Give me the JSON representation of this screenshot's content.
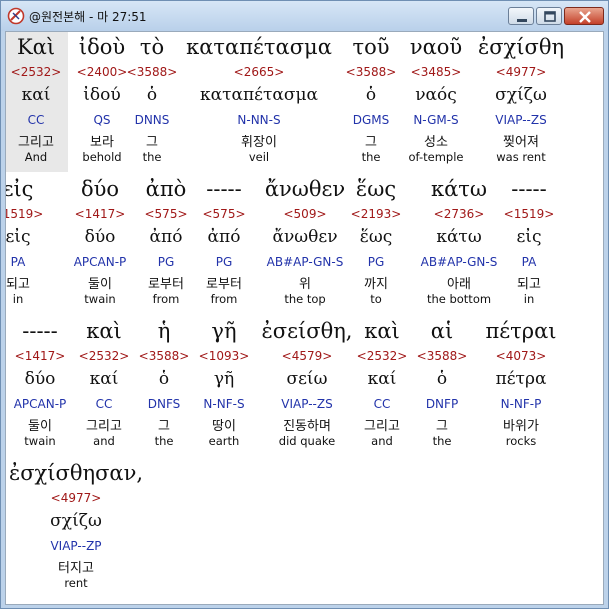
{
  "window": {
    "title": "@원전본해 - 마 27:51"
  },
  "rows": [
    [
      {
        "greek": "Καὶ",
        "strong": "<2532>",
        "lemma": "καί",
        "parse": "CC",
        "korean": "그리고",
        "english": "And"
      },
      {
        "greek": "ἰδοὺ",
        "strong": "<2400>",
        "lemma": "ἰδού",
        "parse": "QS",
        "korean": "보라",
        "english": "behold"
      },
      {
        "greek": "τὸ",
        "strong": "<3588>",
        "lemma": "ὁ",
        "parse": "DNNS",
        "korean": "그",
        "english": "the"
      },
      {
        "greek": "καταπέτασμα",
        "strong": "<2665>",
        "lemma": "καταπέτασμα",
        "parse": "N-NN-S",
        "korean": "휘장이",
        "english": "veil"
      },
      {
        "greek": "τοῦ",
        "strong": "<3588>",
        "lemma": "ὁ",
        "parse": "DGMS",
        "korean": "그",
        "english": "the"
      },
      {
        "greek": "ναοῦ",
        "strong": "<3485>",
        "lemma": "ναός",
        "parse": "N-GM-S",
        "korean": "성소",
        "english": "of-temple"
      },
      {
        "greek": "ἐσχίσθη",
        "strong": "<4977>",
        "lemma": "σχίζω",
        "parse": "VIAP--ZS",
        "korean": "찢어져",
        "english": "was rent"
      }
    ],
    [
      {
        "greek": "εἰς",
        "strong": "<1519>",
        "lemma": "εἰς",
        "parse": "PA",
        "korean": "되고",
        "english": "in"
      },
      {
        "greek": "δύο",
        "strong": "<1417>",
        "lemma": "δύο",
        "parse": "APCAN-P",
        "korean": "둘이",
        "english": "twain"
      },
      {
        "greek": "ἀπὸ",
        "strong": "<575>",
        "lemma": "ἀπό",
        "parse": "PG",
        "korean": "로부터",
        "english": "from"
      },
      {
        "greek": "-----",
        "strong": "<575>",
        "lemma": "ἀπό",
        "parse": "PG",
        "korean": "로부터",
        "english": "from"
      },
      {
        "greek": "ἄνωθεν",
        "strong": "<509>",
        "lemma": "ἄνωθεν",
        "parse": "AB#AP-GN-S",
        "korean": "위",
        "english": "the top"
      },
      {
        "greek": "ἕως",
        "strong": "<2193>",
        "lemma": "ἕως",
        "parse": "PG",
        "korean": "까지",
        "english": "to"
      },
      {
        "greek": "κάτω",
        "strong": "<2736>",
        "lemma": "κάτω",
        "parse": "AB#AP-GN-S",
        "korean": "아래",
        "english": "the bottom"
      },
      {
        "greek": "-----",
        "strong": "<1519>",
        "lemma": "εἰς",
        "parse": "PA",
        "korean": "되고",
        "english": "in"
      }
    ],
    [
      {
        "greek": "-----",
        "strong": "<1417>",
        "lemma": "δύο",
        "parse": "APCAN-P",
        "korean": "둘이",
        "english": "twain"
      },
      {
        "greek": "καὶ",
        "strong": "<2532>",
        "lemma": "καί",
        "parse": "CC",
        "korean": "그리고",
        "english": "and"
      },
      {
        "greek": "ἡ",
        "strong": "<3588>",
        "lemma": "ὁ",
        "parse": "DNFS",
        "korean": "그",
        "english": "the"
      },
      {
        "greek": "γῆ",
        "strong": "<1093>",
        "lemma": "γῆ",
        "parse": "N-NF-S",
        "korean": "땅이",
        "english": "earth"
      },
      {
        "greek": "ἐσείσθη,",
        "strong": "<4579>",
        "lemma": "σείω",
        "parse": "VIAP--ZS",
        "korean": "진동하며",
        "english": "did quake"
      },
      {
        "greek": "καὶ",
        "strong": "<2532>",
        "lemma": "καί",
        "parse": "CC",
        "korean": "그리고",
        "english": "and"
      },
      {
        "greek": "αἱ",
        "strong": "<3588>",
        "lemma": "ὁ",
        "parse": "DNFP",
        "korean": "그",
        "english": "the"
      },
      {
        "greek": "πέτραι",
        "strong": "<4073>",
        "lemma": "πέτρα",
        "parse": "N-NF-P",
        "korean": "바위가",
        "english": "rocks"
      }
    ],
    [
      {
        "greek": "ἐσχίσθησαν,",
        "strong": "<4977>",
        "lemma": "σχίζω",
        "parse": "VIAP--ZP",
        "korean": "터지고",
        "english": "rent"
      }
    ]
  ]
}
